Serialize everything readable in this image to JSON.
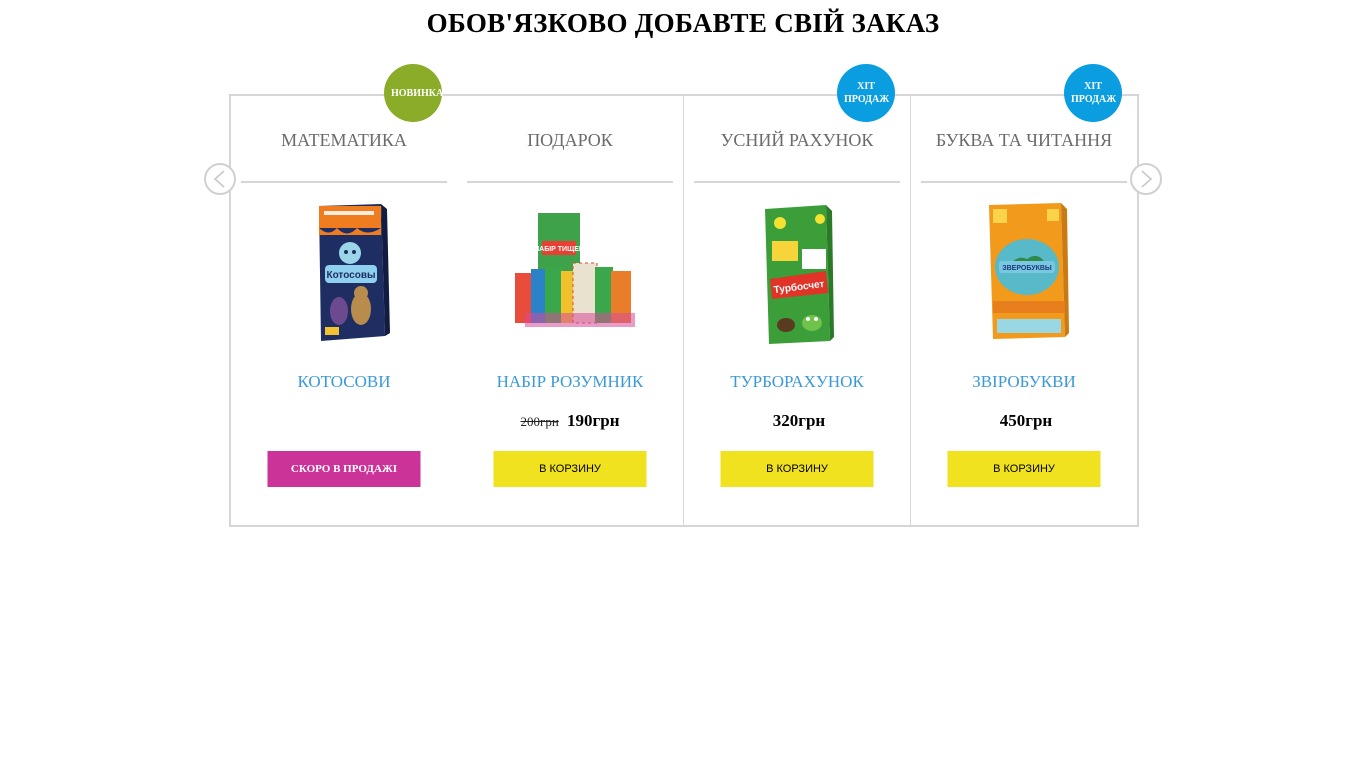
{
  "page": {
    "title": "ОБОВ'ЯЗКОВО ДОБАВТЕ СВІЙ ЗАКАЗ"
  },
  "slider": {
    "prev_icon": "chevron-left-icon",
    "next_icon": "chevron-right-icon",
    "products": [
      {
        "category": "МАТЕМАТИКА",
        "badge": "НОВИНКА",
        "badge_type": "new",
        "badge_color": "#8aac28",
        "name": "КОТОСОВИ",
        "old_price": "",
        "price": "",
        "button": "СКОРО В ПРОДАЖІ",
        "button_color": "#cc3399"
      },
      {
        "category": "ПОДАРОК",
        "badge": "",
        "name": "НАБІР РОЗУМНИК",
        "old_price": "200грн",
        "price": "190грн",
        "button": "В КОРЗИНУ",
        "button_color": "#f0e21f"
      },
      {
        "category": "УСНИЙ РАХУНОК",
        "badge": "ХІТ ПРОДАЖ",
        "badge_type": "hit",
        "badge_color": "#0a9ee0",
        "name": "ТУРБОРАХУНОК",
        "old_price": "",
        "price": "320грн",
        "button": "В КОРЗИНУ",
        "button_color": "#f0e21f"
      },
      {
        "category": "БУКВА ТА ЧИТАННЯ",
        "badge": "ХІТ ПРОДАЖ",
        "badge_type": "hit",
        "badge_color": "#0a9ee0",
        "name": "ЗВІРОБУКВИ",
        "old_price": "",
        "price": "450грн",
        "button": "В КОРЗИНУ",
        "button_color": "#f0e21f"
      }
    ],
    "box_texts": {
      "kotosovy": "Котосовы",
      "nabir": "НАБІР ТИЩЕЙ",
      "turbo": "Турбосчет",
      "zviro": "ЗВЕРОБУКВЫ"
    }
  }
}
